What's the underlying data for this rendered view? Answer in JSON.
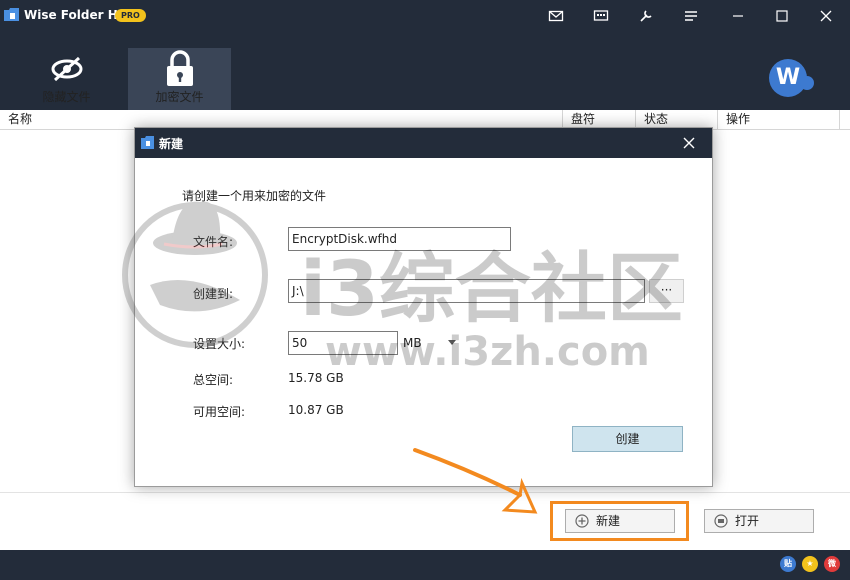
{
  "app": {
    "title": "Wise Folder Hider",
    "badge": "PRO"
  },
  "toolbar": {
    "tabs": [
      {
        "label": "隐藏文件"
      },
      {
        "label": "加密文件"
      }
    ],
    "avatar_letter": "W"
  },
  "columns": [
    "名称",
    "盘符",
    "状态",
    "操作"
  ],
  "dialog": {
    "title": "新建",
    "prompt": "请创建一个用来加密的文件",
    "file_name_label": "文件名:",
    "file_name_value": "EncryptDisk.wfhd",
    "create_in_label": "创建到:",
    "create_in_value": "J:\\",
    "browse_label": "···",
    "size_label": "设置大小:",
    "size_value": "50",
    "size_unit": "MB",
    "total_label": "总空间:",
    "total_value": "15.78 GB",
    "free_label": "可用空间:",
    "free_value": "10.87 GB",
    "create_button": "创建"
  },
  "actions": {
    "new_label": "新建",
    "open_label": "打开"
  },
  "watermark": {
    "text": "i3综合社区",
    "url": "www.i3zh.com"
  },
  "colors": {
    "chrome": "#232c3a",
    "active_tab": "#3a4557",
    "highlight": "#f38a1f",
    "pro_badge": "#f2c21c",
    "create_button": "#cfe4ee"
  }
}
